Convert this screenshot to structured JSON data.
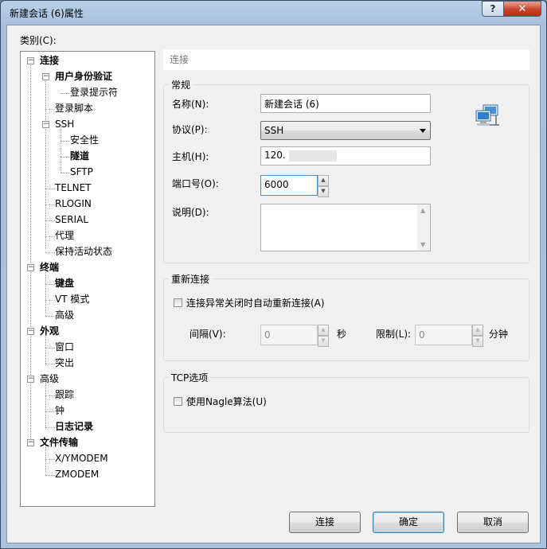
{
  "window": {
    "title": "新建会话 (6)属性",
    "help_btn": "?",
    "close_btn": "✕"
  },
  "category_label": "类别(C):",
  "tree": [
    {
      "label": "连接",
      "bold": true
    },
    {
      "label": "用户身份验证",
      "bold": true
    },
    {
      "label": "登录提示符",
      "bold": false
    },
    {
      "label": "登录脚本",
      "bold": false
    },
    {
      "label": "SSH",
      "bold": false
    },
    {
      "label": "安全性",
      "bold": false
    },
    {
      "label": "隧道",
      "bold": true
    },
    {
      "label": "SFTP",
      "bold": false
    },
    {
      "label": "TELNET",
      "bold": false
    },
    {
      "label": "RLOGIN",
      "bold": false
    },
    {
      "label": "SERIAL",
      "bold": false
    },
    {
      "label": "代理",
      "bold": false
    },
    {
      "label": "保持活动状态",
      "bold": false
    },
    {
      "label": "终端",
      "bold": true
    },
    {
      "label": "键盘",
      "bold": true
    },
    {
      "label": "VT 模式",
      "bold": false
    },
    {
      "label": "高级",
      "bold": false
    },
    {
      "label": "外观",
      "bold": true
    },
    {
      "label": "窗口",
      "bold": false
    },
    {
      "label": "突出",
      "bold": false
    },
    {
      "label": "高级",
      "bold": false
    },
    {
      "label": "跟踪",
      "bold": false
    },
    {
      "label": "钟",
      "bold": false
    },
    {
      "label": "日志记录",
      "bold": true
    },
    {
      "label": "文件传输",
      "bold": true
    },
    {
      "label": "X/YMODEM",
      "bold": false
    },
    {
      "label": "ZMODEM",
      "bold": false
    }
  ],
  "tree_toggle_collapse": "−",
  "panel_header": "连接",
  "general": {
    "title": "常规",
    "name_label": "名称(N):",
    "name_value": "新建会话 (6)",
    "protocol_label": "协议(P):",
    "protocol_value": "SSH",
    "host_label": "主机(H):",
    "host_value": "120.",
    "port_label": "端口号(O):",
    "port_value": "6000",
    "desc_label": "说明(D):"
  },
  "reconnect": {
    "title": "重新连接",
    "auto_label": "连接异常关闭时自动重新连接(A)",
    "interval_label": "间隔(V):",
    "interval_value": "0",
    "interval_unit": "秒",
    "limit_label": "限制(L):",
    "limit_value": "0",
    "limit_unit": "分钟"
  },
  "tcp": {
    "title": "TCP选项",
    "nagle_label": "使用Nagle算法(U)"
  },
  "spin_up": "▲",
  "spin_down": "▼",
  "buttons": {
    "connect": "连接",
    "ok": "确定",
    "cancel": "取消"
  }
}
